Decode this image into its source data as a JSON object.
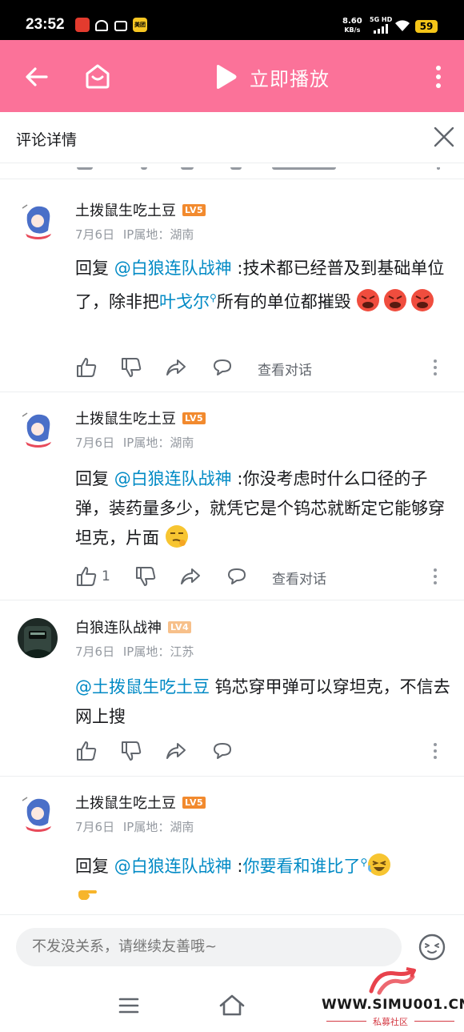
{
  "status_bar": {
    "time": "23:52",
    "net_speed_value": "8.60",
    "net_speed_unit": "KB/s",
    "network": "5G HD",
    "battery": "59",
    "app_badge": "美团"
  },
  "topbar": {
    "play_label": "立即播放"
  },
  "detail": {
    "title": "评论详情"
  },
  "comments": [
    {
      "user": "土拨鼠生吃土豆",
      "level": "LV5",
      "date": "7月6日",
      "ip": "IP属地：湖南",
      "reply_prefix": "回复 ",
      "mention": "@白狼连队战神",
      "text_a": " :技术都已经普及到基础单位了，除非把",
      "link": "叶戈尔",
      "text_b": "所有的单位都摧毁",
      "emojis": [
        "angry-face",
        "angry-face",
        "angry-face"
      ],
      "like_count": "",
      "view_dialog": "查看对话"
    },
    {
      "user": "土拨鼠生吃土豆",
      "level": "LV5",
      "date": "7月6日",
      "ip": "IP属地：湖南",
      "reply_prefix": "回复 ",
      "mention": "@白狼连队战神",
      "text_a": " :你没考虑时什么口径的子弹，装药量多少，就凭它是个钨芯就断定它能够穿坦克，片面",
      "emojis": [
        "smirk-face"
      ],
      "like_count": "1",
      "view_dialog": "查看对话"
    },
    {
      "user": "白狼连队战神",
      "level": "LV4",
      "date": "7月6日",
      "ip": "IP属地：江苏",
      "mention": "@土拨鼠生吃土豆",
      "text_a": " 钨芯穿甲弹可以穿坦克，不信去网上搜",
      "like_count": ""
    },
    {
      "user": "土拨鼠生吃土豆",
      "level": "LV5",
      "date": "7月6日",
      "ip": "IP属地：湖南",
      "reply_prefix": "回复 ",
      "mention": "@白狼连队战神",
      "text_a": " :",
      "link": "你要看和谁比了",
      "emojis": [
        "laughing-face",
        "pointing-hand"
      ]
    }
  ],
  "input": {
    "placeholder": "不发没关系，请继续友善哦~"
  },
  "watermark": {
    "url": "WWW.SIMU001.CN",
    "sub": "私募社区"
  },
  "colors": {
    "brand_pink": "#fb7299",
    "mention_blue": "#008ac5",
    "lv5": "#f28a2e",
    "lv4": "#f7c08a"
  }
}
